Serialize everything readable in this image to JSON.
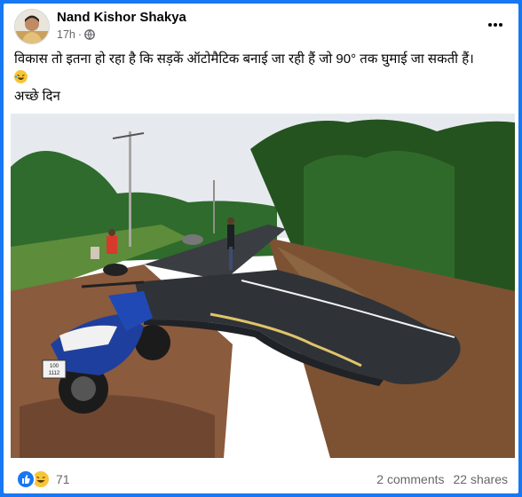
{
  "post": {
    "author": "Nand Kishor Shakya",
    "time": "17h",
    "separator": "·",
    "text_line1": "विकास तो इतना हो रहा है कि सड़कें ऑटोमैटिक बनाई जा रही हैं जो 90° तक घुमाई जा सकती हैं।",
    "text_line2": "अच्छे दिन"
  },
  "photo": {
    "scooter_plate": "100 1112"
  },
  "footer": {
    "reaction_count": "71",
    "comments": "2 comments",
    "shares": "22 shares"
  },
  "colors": {
    "frame": "#1877f2",
    "meta_text": "#65676b",
    "like": "#1877f2",
    "haha": "#f7c53a"
  },
  "icons": [
    "globe-icon",
    "more-options-icon",
    "laugh-emoji-icon",
    "like-reaction-icon",
    "haha-reaction-icon"
  ]
}
